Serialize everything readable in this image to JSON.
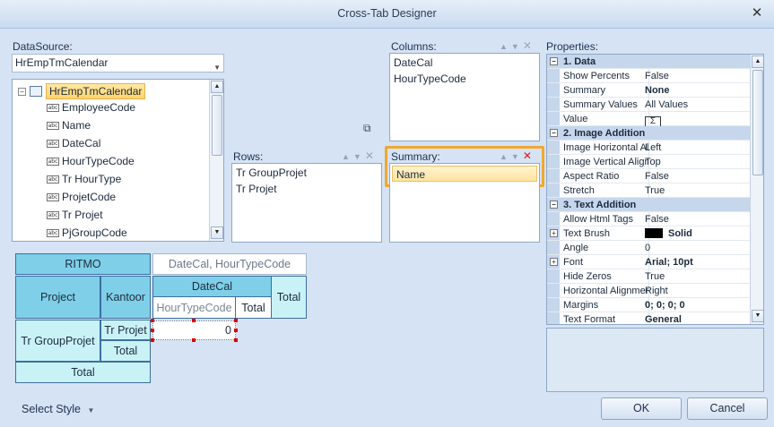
{
  "window": {
    "title": "Cross-Tab Designer",
    "close_glyph": "✕"
  },
  "datasource": {
    "label": "DataSource:",
    "selected": "HrEmpTmCalendar",
    "tree": {
      "root": "HrEmpTmCalendar",
      "fields": [
        "EmployeeCode",
        "Name",
        "DateCal",
        "HourTypeCode",
        "Tr HourType",
        "ProjetCode",
        "Tr Projet",
        "PjGroupCode"
      ],
      "field_icon": "abc"
    }
  },
  "columns": {
    "label": "Columns:",
    "items": [
      "DateCal",
      "HourTypeCode"
    ]
  },
  "rows": {
    "label": "Rows:",
    "items": [
      "Tr GroupProjet",
      "Tr Projet"
    ]
  },
  "summary": {
    "label": "Summary:",
    "items": [
      "Name"
    ]
  },
  "header_icons": {
    "up": "▲",
    "down": "▼",
    "remove": "✕"
  },
  "layout_grid": {
    "corner": "RITMO",
    "column_fields_caption": "DateCal, HourTypeCode",
    "row_header_1": "Project",
    "row_header_2": "Kantoor",
    "col_header_1": "DateCal",
    "col_header_2": "HourTypeCode",
    "col_total_inner": "Total",
    "col_total_outer": "Total",
    "row_value_1": "Tr GroupProjet",
    "row_value_2": "Tr Projet",
    "row_total_inner": "Total",
    "row_total_outer": "Total",
    "data_cell": "0"
  },
  "properties": {
    "label": "Properties:",
    "rows": [
      {
        "type": "category",
        "key": "1. Data"
      },
      {
        "key": "Show Percents",
        "value": "False"
      },
      {
        "key": "Summary",
        "value": "None",
        "bold": true
      },
      {
        "key": "Summary Values",
        "value": "All Values"
      },
      {
        "key": "Value",
        "value": "Σ",
        "kind": "sigma"
      },
      {
        "type": "category",
        "key": "2. Image Addition"
      },
      {
        "key": "Image Horizontal Alignment",
        "value": "Left"
      },
      {
        "key": "Image Vertical Alignment",
        "value": "Top"
      },
      {
        "key": "Aspect Ratio",
        "value": "False"
      },
      {
        "key": "Stretch",
        "value": "True"
      },
      {
        "type": "category",
        "key": "3. Text Addition"
      },
      {
        "key": "Allow Html Tags",
        "value": "False"
      },
      {
        "key": "Text Brush",
        "value": "Solid",
        "bold": true,
        "kind": "brush",
        "expandable": true
      },
      {
        "key": "Angle",
        "value": "0"
      },
      {
        "key": "Font",
        "value": "Arial; 10pt",
        "bold": true,
        "expandable": true
      },
      {
        "key": "Hide Zeros",
        "value": "True"
      },
      {
        "key": "Horizontal Alignment",
        "value": "Right"
      },
      {
        "key": "Margins",
        "value": "0; 0; 0; 0",
        "bold": true
      },
      {
        "key": "Text Format",
        "value": "General",
        "bold": true
      }
    ]
  },
  "footer": {
    "select_style": "Select Style",
    "ok": "OK",
    "cancel": "Cancel"
  },
  "colors": {
    "accent_highlight": "#f0a830",
    "grid_blue": "#7fcfe8",
    "grid_light": "#c9f2f6"
  }
}
